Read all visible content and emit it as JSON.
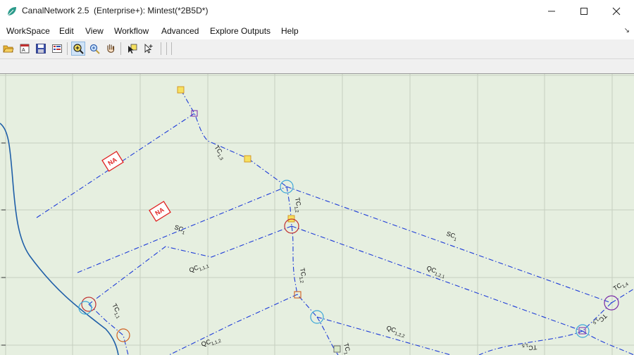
{
  "window": {
    "title": "CanalNetwork 2.5  (Enterprise+): Mintest(*2B5D*)"
  },
  "menu": {
    "items": [
      "WorkSpace",
      "Edit",
      "View",
      "Workflow",
      "Advanced",
      "Explore Outputs",
      "Help"
    ]
  },
  "toolbar": {
    "icons": [
      "open-folder-icon",
      "properties-icon",
      "save-icon",
      "settings-list-icon",
      "zoom-window-icon",
      "zoom-in-icon",
      "pan-hand-icon",
      "select-node-icon",
      "pointer-add-icon"
    ],
    "active": "zoom-window-icon"
  },
  "map": {
    "colors": {
      "background": "#e6efe0",
      "grid": "#c6cfc0",
      "canal": "#1f5fa8",
      "channel": "#1e3cd8",
      "na_marker": "#e02020"
    },
    "labels": [
      {
        "main": "TC",
        "sub": "1,3"
      },
      {
        "main": "TC",
        "sub": "1,2"
      },
      {
        "main": "SC",
        "sub": "1"
      },
      {
        "main": "SC",
        "sub": "1"
      },
      {
        "main": "QC",
        "sub": "1,1,1"
      },
      {
        "main": "QC",
        "sub": "1,2,1"
      },
      {
        "main": "TC",
        "sub": "1,2"
      },
      {
        "main": "TC",
        "sub": "1,1"
      },
      {
        "main": "QC",
        "sub": "1,1,2"
      },
      {
        "main": "QC",
        "sub": "1,2,2"
      },
      {
        "main": "TC",
        "sub": "1,4"
      },
      {
        "main": "TC",
        "sub": "1,5"
      },
      {
        "main": "TC",
        "sub": "1,5"
      },
      {
        "main": "TC",
        "sub": "1"
      }
    ],
    "na_markers": [
      "NA",
      "NA"
    ]
  }
}
